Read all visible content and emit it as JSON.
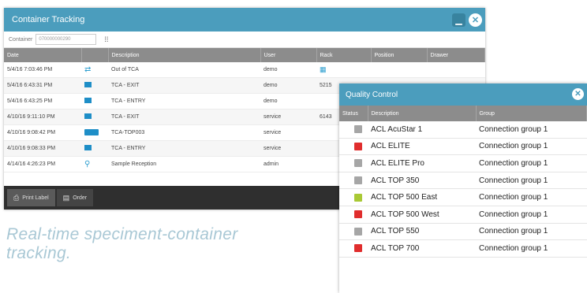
{
  "container_tracking": {
    "title": "Container Tracking",
    "minimize_icon": "minimize-icon",
    "close_icon": "close-icon",
    "container_label": "Container",
    "container_value": "070000000290",
    "columns": [
      "Date",
      "",
      "Description",
      "User",
      "Rack",
      "Position",
      "Drawer"
    ],
    "rows": [
      {
        "date": "5/4/16 7:03:46 PM",
        "icon": "transfer-icon",
        "description": "Out of TCA",
        "user": "demo",
        "rack": "",
        "position": "",
        "drawer": ""
      },
      {
        "date": "5/4/16 6:43:31 PM",
        "icon": "flag-icon",
        "description": "TCA - EXIT",
        "user": "demo",
        "rack": "5215",
        "position": "",
        "drawer": ""
      },
      {
        "date": "5/4/16 6:43:25 PM",
        "icon": "flag-icon",
        "description": "TCA - ENTRY",
        "user": "demo",
        "rack": "",
        "position": "",
        "drawer": ""
      },
      {
        "date": "4/10/16 9:11:10 PM",
        "icon": "flag-icon",
        "description": "TCA - EXIT",
        "user": "service",
        "rack": "6143",
        "position": "",
        "drawer": ""
      },
      {
        "date": "4/10/16 9:08:42 PM",
        "icon": "analyzer-icon",
        "description": "TCA-TOP003",
        "user": "service",
        "rack": "",
        "position": "",
        "drawer": ""
      },
      {
        "date": "4/10/16 9:08:33 PM",
        "icon": "flag-icon",
        "description": "TCA - ENTRY",
        "user": "service",
        "rack": "",
        "position": "",
        "drawer": ""
      },
      {
        "date": "4/14/16 4:26:23 PM",
        "icon": "location-pin-icon",
        "description": "Sample Reception",
        "user": "admin",
        "rack": "",
        "position": "",
        "drawer": ""
      }
    ],
    "footer": {
      "print_label": "Print Label",
      "order_label": "Order"
    }
  },
  "caption": "Real-time speciment-container tracking.",
  "quality_control": {
    "title": "Quality Control",
    "close_icon": "close-icon",
    "columns": [
      "Status",
      "Description",
      "Group"
    ],
    "rows": [
      {
        "status_color": "#a6a6a6",
        "description": "ACL AcuStar 1",
        "group": "Connection group 1"
      },
      {
        "status_color": "#e02d2d",
        "description": "ACL ELITE",
        "group": "Connection group 1"
      },
      {
        "status_color": "#a6a6a6",
        "description": "ACL ELITE Pro",
        "group": "Connection group 1"
      },
      {
        "status_color": "#a6a6a6",
        "description": "ACL TOP 350",
        "group": "Connection group 1"
      },
      {
        "status_color": "#a9c935",
        "description": "ACL TOP 500 East",
        "group": "Connection group 1"
      },
      {
        "status_color": "#e02d2d",
        "description": "ACL TOP 500 West",
        "group": "Connection group 1"
      },
      {
        "status_color": "#a6a6a6",
        "description": "ACL TOP 550",
        "group": "Connection group 1"
      },
      {
        "status_color": "#e02d2d",
        "description": "ACL TOP 700",
        "group": "Connection group 1"
      }
    ]
  },
  "colors": {
    "titlebar": "#4b9dbd",
    "header": "#8c8c8c",
    "footer": "#2f2f2f",
    "caption": "#a9c8d5"
  }
}
